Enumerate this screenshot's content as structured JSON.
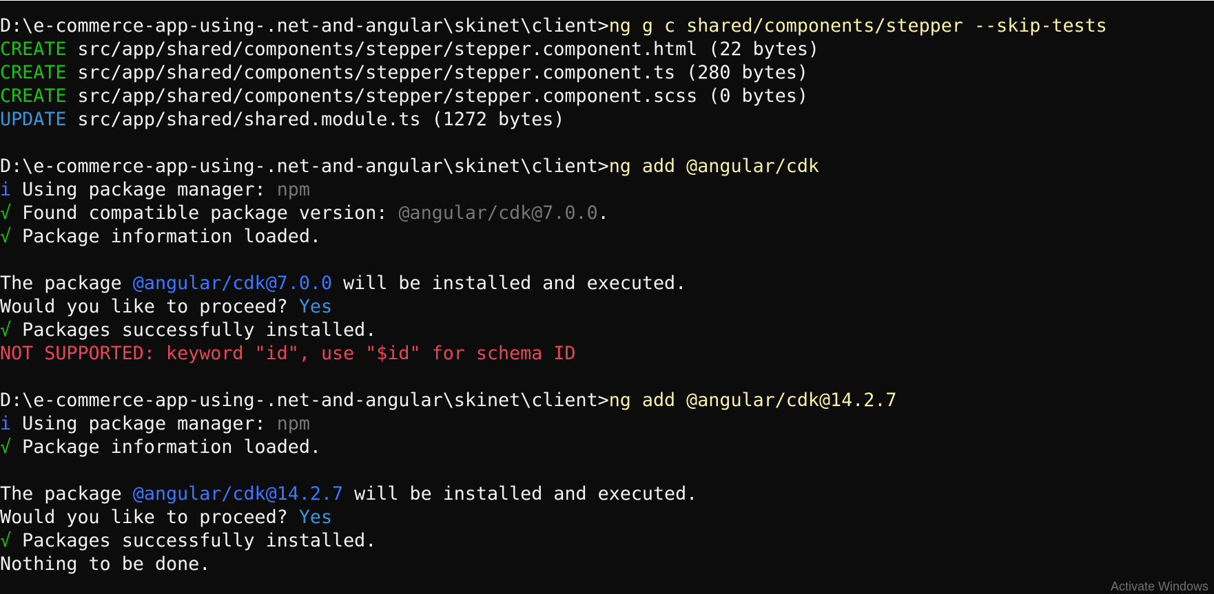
{
  "colors": {
    "default": "#cccccc",
    "command": "#f9f1a5",
    "success": "#16c60c",
    "info": "#3b78ff",
    "update": "#3a96dd",
    "muted": "#767676",
    "package": "#3b78ff",
    "answer": "#3a96dd",
    "error": "#e74856",
    "white": "#f2f2f2"
  },
  "terminal": {
    "lines": [
      [
        {
          "t": "D:\\e-commerce-app-using-.net-and-angular\\skinet\\client>",
          "c": "white"
        },
        {
          "t": "ng g c shared/components/stepper --skip-tests",
          "c": "command"
        }
      ],
      [
        {
          "t": "CREATE",
          "c": "success"
        },
        {
          "t": " src/app/shared/components/stepper/stepper.component.html (22 bytes)",
          "c": "white"
        }
      ],
      [
        {
          "t": "CREATE",
          "c": "success"
        },
        {
          "t": " src/app/shared/components/stepper/stepper.component.ts (280 bytes)",
          "c": "white"
        }
      ],
      [
        {
          "t": "CREATE",
          "c": "success"
        },
        {
          "t": " src/app/shared/components/stepper/stepper.component.scss (0 bytes)",
          "c": "white"
        }
      ],
      [
        {
          "t": "UPDATE",
          "c": "update"
        },
        {
          "t": " src/app/shared/shared.module.ts (1272 bytes)",
          "c": "white"
        }
      ],
      [],
      [
        {
          "t": "D:\\e-commerce-app-using-.net-and-angular\\skinet\\client>",
          "c": "white"
        },
        {
          "t": "ng add @angular/cdk",
          "c": "command"
        }
      ],
      [
        {
          "t": "i",
          "c": "info"
        },
        {
          "t": " Using package manager: ",
          "c": "white"
        },
        {
          "t": "npm",
          "c": "muted"
        }
      ],
      [
        {
          "t": "√",
          "c": "success"
        },
        {
          "t": " Found compatible package version: ",
          "c": "white"
        },
        {
          "t": "@angular/cdk@7.0.0",
          "c": "muted"
        },
        {
          "t": ".",
          "c": "white"
        }
      ],
      [
        {
          "t": "√",
          "c": "success"
        },
        {
          "t": " Package information loaded.",
          "c": "white"
        }
      ],
      [],
      [
        {
          "t": "The package ",
          "c": "white"
        },
        {
          "t": "@angular/cdk@7.0.0",
          "c": "package"
        },
        {
          "t": " will be installed and executed.",
          "c": "white"
        }
      ],
      [
        {
          "t": "Would you like to proceed? ",
          "c": "white"
        },
        {
          "t": "Yes",
          "c": "answer"
        }
      ],
      [
        {
          "t": "√",
          "c": "success"
        },
        {
          "t": " Packages successfully installed.",
          "c": "white"
        }
      ],
      [
        {
          "t": "NOT SUPPORTED: keyword \"id\", use \"$id\" for schema ID",
          "c": "error"
        }
      ],
      [],
      [
        {
          "t": "D:\\e-commerce-app-using-.net-and-angular\\skinet\\client>",
          "c": "white"
        },
        {
          "t": "ng add @angular/cdk@14.2.7",
          "c": "command"
        }
      ],
      [
        {
          "t": "i",
          "c": "info"
        },
        {
          "t": " Using package manager: ",
          "c": "white"
        },
        {
          "t": "npm",
          "c": "muted"
        }
      ],
      [
        {
          "t": "√",
          "c": "success"
        },
        {
          "t": " Package information loaded.",
          "c": "white"
        }
      ],
      [],
      [
        {
          "t": "The package ",
          "c": "white"
        },
        {
          "t": "@angular/cdk@14.2.7",
          "c": "package"
        },
        {
          "t": " will be installed and executed.",
          "c": "white"
        }
      ],
      [
        {
          "t": "Would you like to proceed? ",
          "c": "white"
        },
        {
          "t": "Yes",
          "c": "answer"
        }
      ],
      [
        {
          "t": "√",
          "c": "success"
        },
        {
          "t": " Packages successfully installed.",
          "c": "white"
        }
      ],
      [
        {
          "t": "Nothing to be done.",
          "c": "white"
        }
      ]
    ]
  },
  "watermark": {
    "text": "Activate Windows"
  }
}
